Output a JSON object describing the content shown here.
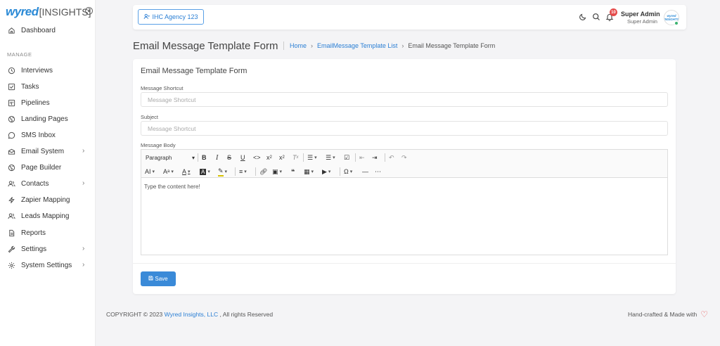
{
  "brand": {
    "wyred": "wyred",
    "insights": "INSIGHTS"
  },
  "sidebar": {
    "section_manage": "MANAGE",
    "items": [
      {
        "label": "Dashboard",
        "icon": "home-icon"
      },
      {
        "label": "Interviews",
        "icon": "clock-icon"
      },
      {
        "label": "Tasks",
        "icon": "checkbox-icon"
      },
      {
        "label": "Pipelines",
        "icon": "kanban-icon"
      },
      {
        "label": "Landing Pages",
        "icon": "globe-icon"
      },
      {
        "label": "SMS Inbox",
        "icon": "chat-icon"
      },
      {
        "label": "Email System",
        "icon": "mail-icon",
        "chevron": "›"
      },
      {
        "label": "Page Builder",
        "icon": "globe-icon"
      },
      {
        "label": "Contacts",
        "icon": "users-icon",
        "chevron": "›"
      },
      {
        "label": "Zapier Mapping",
        "icon": "bolt-icon"
      },
      {
        "label": "Leads Mapping",
        "icon": "users-icon"
      },
      {
        "label": "Reports",
        "icon": "file-icon"
      },
      {
        "label": "Settings",
        "icon": "wrench-icon",
        "chevron": "›"
      },
      {
        "label": "System Settings",
        "icon": "gear-icon",
        "chevron": "›"
      }
    ]
  },
  "topbar": {
    "agency": "IHC Agency 123",
    "notifications": "10",
    "user_name": "Super Admin",
    "user_role": "Super Admin",
    "avatar_text": "wyred INSIGHTS"
  },
  "page": {
    "title": "Email Message Template Form",
    "breadcrumb": {
      "home": "Home",
      "list": "EmailMessage Template List",
      "current": "Email Message Template Form"
    }
  },
  "form": {
    "title": "Email Message Template Form",
    "shortcut_label": "Message Shortcut",
    "shortcut_placeholder": "Message Shortcut",
    "subject_label": "Subject",
    "subject_placeholder": "Message Shortcut",
    "body_label": "Message Body",
    "body_placeholder": "Type the content here!",
    "paragraph": "Paragraph",
    "save": "Save"
  },
  "footer": {
    "copyright_prefix": "COPYRIGHT © 2023",
    "company": "Wyred Insights, LLC",
    "copyright_suffix": ", All rights Reserved",
    "handcrafted": "Hand-crafted & Made with"
  },
  "colors": {
    "accent": "#2b7fd4",
    "save_button": "#3a8ad8",
    "badge": "#e54b4b"
  }
}
